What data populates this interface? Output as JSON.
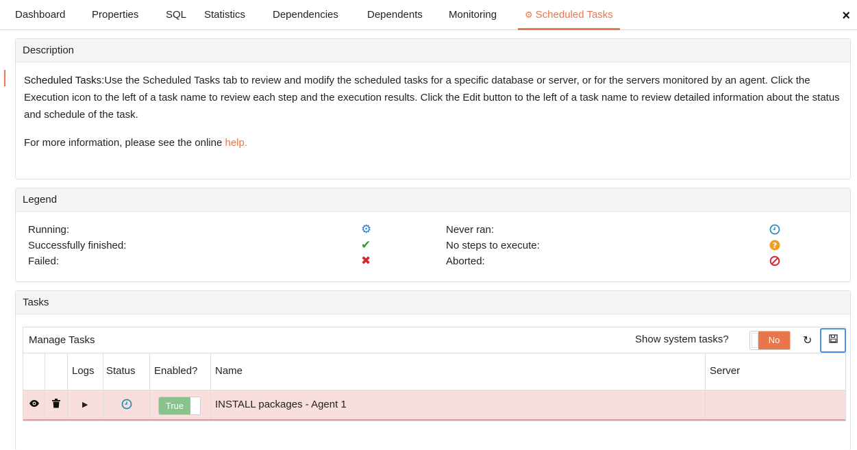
{
  "tabs": [
    "Dashboard",
    "Properties",
    "SQL",
    "Statistics",
    "Dependencies",
    "Dependents",
    "Monitoring",
    "Scheduled Tasks"
  ],
  "active_tab": "Scheduled Tasks",
  "close_label": "×",
  "description": {
    "header": "Description",
    "lead": "Scheduled Tasks:",
    "text": "Use the Scheduled Tasks tab to review and modify the scheduled tasks for a specific database or server, or for the servers monitored by an agent. Click the Execution icon to the left of a task name to review each step and the execution results. Click the Edit button to the left of a task name to review detailed information about the status and schedule of the task.",
    "more": "For more information, please see the online",
    "help_link": "help."
  },
  "legend": {
    "header": "Legend",
    "left": [
      {
        "label": "Running:",
        "icon": "gear-icon",
        "color": "#2a7fd4"
      },
      {
        "label": "Successfully finished:",
        "icon": "check-icon",
        "color": "#2e9b3c"
      },
      {
        "label": "Failed:",
        "icon": "x-icon",
        "color": "#d9262c"
      }
    ],
    "right": [
      {
        "label": "Never ran:",
        "icon": "clock-icon",
        "color": "#2a8fb8"
      },
      {
        "label": "No steps to execute:",
        "icon": "question-icon",
        "color": "#f0a020"
      },
      {
        "label": "Aborted:",
        "icon": "ban-icon",
        "color": "#d9262c"
      }
    ]
  },
  "tasks": {
    "header": "Tasks",
    "manage_title": "Manage Tasks",
    "system_label": "Show system tasks?",
    "system_toggle": "No",
    "columns": [
      "Logs",
      "Status",
      "Enabled?",
      "Name",
      "Server"
    ],
    "rows": [
      {
        "enabled": "True",
        "name": "INSTALL packages - Agent 1",
        "server": "",
        "status_icon": "clock-icon"
      }
    ]
  },
  "colors": {
    "accent": "#e8764a",
    "focus": "#4a90d9",
    "row_error": "#f9dede"
  }
}
